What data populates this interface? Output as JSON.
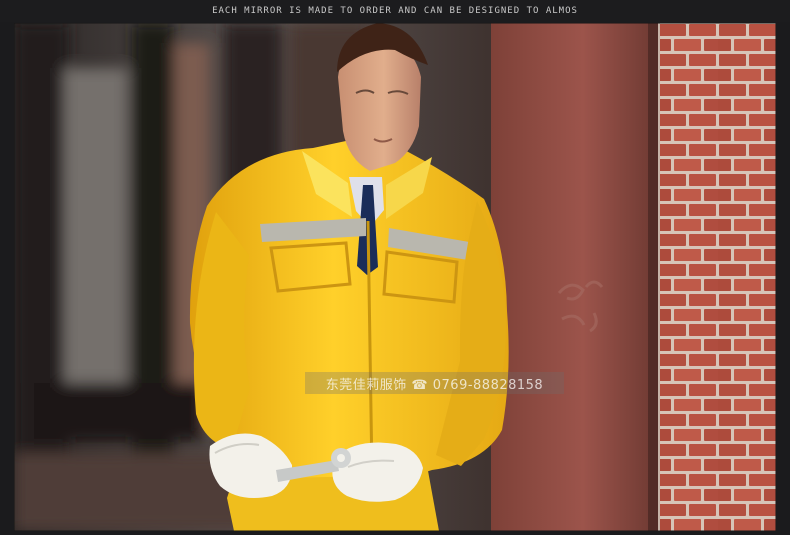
{
  "banner": {
    "text": "EACH MIRROR IS MADE TO ORDER AND CAN BE DESIGNED TO ALMOS"
  },
  "watermark": {
    "text": "东莞佳莉服饰 ☎ 0769-88828158"
  },
  "colors": {
    "uniform_yellow": "#f0bb18",
    "reflective_stripe": "#b9b7ae",
    "pillar_red": "#9a5148",
    "brick_red": "#b84d3d",
    "mortar": "#d8c6b8",
    "glove_white": "#f3f1ea",
    "tie_navy": "#1b2d59"
  },
  "icons": {
    "phone": "phone-icon",
    "wrench": "wrench-icon"
  }
}
